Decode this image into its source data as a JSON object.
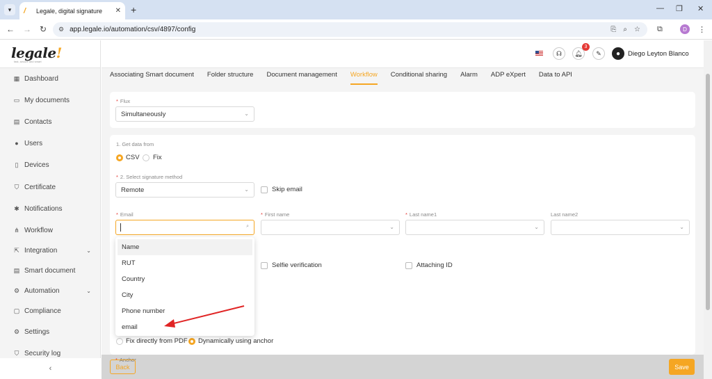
{
  "browser": {
    "tab_title": "Legale, digital signature",
    "url": "app.legale.io/automation/csv/4897/config",
    "profile_initial": "D"
  },
  "sidebar": {
    "logo": "legale",
    "logo_mark": "!",
    "logo_tagline": "fast, secure and smart",
    "items": [
      {
        "label": "Dashboard",
        "icon": "dashboard-icon"
      },
      {
        "label": "My documents",
        "icon": "folder-icon"
      },
      {
        "label": "Contacts",
        "icon": "contacts-icon"
      },
      {
        "label": "Users",
        "icon": "user-icon"
      },
      {
        "label": "Devices",
        "icon": "device-icon"
      },
      {
        "label": "Certificate",
        "icon": "shield-icon"
      },
      {
        "label": "Notifications",
        "icon": "notification-icon"
      },
      {
        "label": "Workflow",
        "icon": "workflow-icon"
      },
      {
        "label": "Integration",
        "icon": "integration-icon"
      },
      {
        "label": "Smart document",
        "icon": "table-icon"
      },
      {
        "label": "Automation",
        "icon": "gear-icon"
      },
      {
        "label": "Compliance",
        "icon": "chat-icon"
      },
      {
        "label": "Settings",
        "icon": "settings-icon"
      },
      {
        "label": "Security log",
        "icon": "shield-check-icon"
      }
    ]
  },
  "header": {
    "notification_count": "3",
    "user_name": "Diego Leyton Blanco"
  },
  "tabs": [
    "Associating Smart document",
    "Folder structure",
    "Document management",
    "Workflow",
    "Conditional sharing",
    "Alarm",
    "ADP eXpert",
    "Data to API"
  ],
  "active_tab": "Workflow",
  "flux": {
    "label": "Flux",
    "value": "Simultaneously"
  },
  "get_data": {
    "label": "1. Get data from",
    "options": [
      "CSV",
      "Fix"
    ],
    "selected": "CSV"
  },
  "signature_method": {
    "label": "2. Select signature method",
    "value": "Remote",
    "skip_email_label": "Skip email"
  },
  "fields": {
    "email_label": "Email",
    "first_name_label": "First name",
    "last_name1_label": "Last name1",
    "last_name2_label": "Last name2"
  },
  "verification": {
    "selfie_label": "Selfie verification",
    "attaching_id_label": "Attaching ID"
  },
  "dropdown_options": [
    "Name",
    "RUT",
    "Country",
    "City",
    "Phone number",
    "email"
  ],
  "position": {
    "options": [
      "Fix directly from PDF",
      "Dynamically using anchor"
    ],
    "selected": "Dynamically using anchor",
    "anchor_label": "Anchor"
  },
  "footer": {
    "back_label": "Back",
    "save_label": "Save"
  },
  "colors": {
    "accent": "#f5a623",
    "annotation_arrow": "#e02424"
  }
}
